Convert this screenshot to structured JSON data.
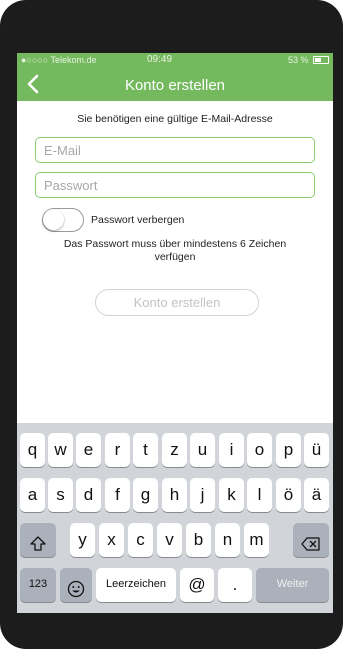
{
  "status": {
    "carrier": "●○○○○ Telekom.de",
    "time": "09:49",
    "battery": "53 %"
  },
  "nav": {
    "title": "Konto erstellen"
  },
  "form": {
    "info": "Sie benötigen eine gültige E-Mail-Adresse",
    "email_placeholder": "E-Mail",
    "password_placeholder": "Passwort",
    "toggle_label": "Passwort verbergen",
    "toggle_on": false,
    "hint": "Das Passwort muss über mindestens 6 Zeichen verfügen",
    "create_label": "Konto erstellen"
  },
  "keyboard": {
    "row1": [
      "q",
      "w",
      "e",
      "r",
      "t",
      "z",
      "u",
      "i",
      "o",
      "p",
      "ü"
    ],
    "row2": [
      "a",
      "s",
      "d",
      "f",
      "g",
      "h",
      "j",
      "k",
      "l",
      "ö",
      "ä"
    ],
    "row3": [
      "y",
      "x",
      "c",
      "v",
      "b",
      "n",
      "m"
    ],
    "numbers": "123",
    "space": "Leerzeichen",
    "at": "@",
    "dot": ".",
    "weiter": "Weiter"
  },
  "colors": {
    "accent": "#74b95e",
    "field_border": "#8ccd74",
    "keyboard_bg": "#d1d4d9"
  }
}
